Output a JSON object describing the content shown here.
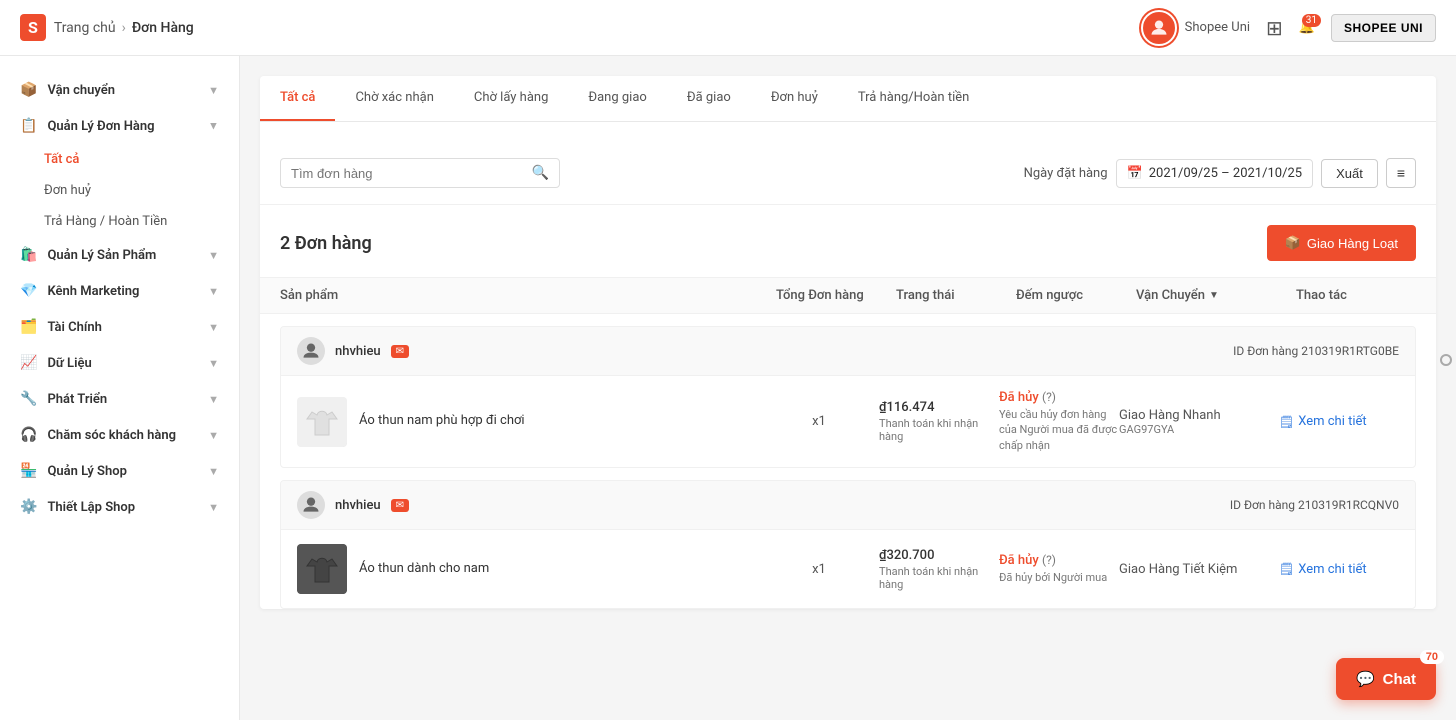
{
  "header": {
    "logo": "S",
    "home_label": "Trang chủ",
    "separator": "›",
    "page_title": "Đơn Hàng",
    "uni_label": "Shopee Uni",
    "notif_count": "31",
    "user_label": "SHOPEE UNI"
  },
  "sidebar": {
    "items": [
      {
        "id": "van-chuyen",
        "label": "Vận chuyển",
        "icon": "📦",
        "has_sub": true,
        "expanded": false
      },
      {
        "id": "quan-ly-don-hang",
        "label": "Quản Lý Đơn Hàng",
        "icon": "📋",
        "has_sub": true,
        "expanded": true
      },
      {
        "id": "quan-ly-san-pham",
        "label": "Quản Lý Sản Phẩm",
        "icon": "🛍️",
        "has_sub": true,
        "expanded": false
      },
      {
        "id": "kenh-marketing",
        "label": "Kênh Marketing",
        "icon": "💎",
        "has_sub": true,
        "expanded": false
      },
      {
        "id": "tai-chinh",
        "label": "Tài Chính",
        "icon": "🗂️",
        "has_sub": true,
        "expanded": false
      },
      {
        "id": "du-lieu",
        "label": "Dữ Liệu",
        "icon": "📈",
        "has_sub": true,
        "expanded": false
      },
      {
        "id": "phat-trien",
        "label": "Phát Triển",
        "icon": "🔧",
        "has_sub": true,
        "expanded": false
      },
      {
        "id": "cham-soc-khach",
        "label": "Chăm sóc khách hàng",
        "icon": "🎧",
        "has_sub": true,
        "expanded": false
      },
      {
        "id": "quan-ly-shop",
        "label": "Quản Lý Shop",
        "icon": "🏪",
        "has_sub": true,
        "expanded": false
      },
      {
        "id": "thiet-lap-shop",
        "label": "Thiết Lập Shop",
        "icon": "⚙️",
        "has_sub": true,
        "expanded": false
      }
    ],
    "submenu_don_hang": [
      {
        "id": "tat-ca",
        "label": "Tất cả",
        "active": true
      },
      {
        "id": "don-huy",
        "label": "Đơn huỷ",
        "active": false
      },
      {
        "id": "tra-hang",
        "label": "Trả Hàng / Hoàn Tiền",
        "active": false
      }
    ]
  },
  "tabs": [
    {
      "id": "tat-ca",
      "label": "Tất cả",
      "active": true
    },
    {
      "id": "cho-xac-nhan",
      "label": "Chờ xác nhận",
      "active": false
    },
    {
      "id": "cho-lay-hang",
      "label": "Chờ lấy hàng",
      "active": false
    },
    {
      "id": "dang-giao",
      "label": "Đang giao",
      "active": false
    },
    {
      "id": "da-giao",
      "label": "Đã giao",
      "active": false
    },
    {
      "id": "don-huy",
      "label": "Đơn huỷ",
      "active": false
    },
    {
      "id": "tra-hang",
      "label": "Trả hàng/Hoàn tiền",
      "active": false
    }
  ],
  "filter": {
    "search_placeholder": "Tìm đơn hàng",
    "date_label": "Ngày đặt hàng",
    "date_value": "2021/09/25 – 2021/10/25",
    "export_label": "Xuất",
    "filter_icon": "≡"
  },
  "order_section": {
    "count_label": "2 Đơn hàng",
    "bulk_ship_label": "Giao Hàng Loạt"
  },
  "table_headers": {
    "product": "Sản phẩm",
    "total": "Tổng Đơn hàng",
    "status": "Trang thái",
    "countdown": "Đếm ngược",
    "shipping": "Vận Chuyển",
    "action": "Thao tác"
  },
  "orders": [
    {
      "id": "order-1",
      "seller": "nhvhieu",
      "order_id_label": "ID Đơn hàng 210319R1RTG0BE",
      "product_name": "Áo thun nam phù hợp đi chơi",
      "qty": "x1",
      "price": "₫116.474",
      "price_note": "Thanh toán khi nhận hàng",
      "status": "Đã hủy",
      "status_note": "Yêu cầu hủy đơn hàng của Người mua đã được chấp nhận",
      "shipping_method": "Giao Hàng Nhanh",
      "shipping_code": "GAG97GYA",
      "action_label": "Xem chi tiết",
      "img_type": "white-shirt"
    },
    {
      "id": "order-2",
      "seller": "nhvhieu",
      "order_id_label": "ID Đơn hàng 210319R1RCQNV0",
      "product_name": "Áo thun dành cho nam",
      "qty": "x1",
      "price": "₫320.700",
      "price_note": "Thanh toán khi nhận hàng",
      "status": "Đã hủy",
      "status_note": "Đã hủy bởi Người mua",
      "shipping_method": "Giao Hàng Tiết Kiệm",
      "shipping_code": "",
      "action_label": "Xem chi tiết",
      "img_type": "dark-shirt"
    }
  ],
  "chat": {
    "label": "Chat",
    "badge": "70"
  }
}
